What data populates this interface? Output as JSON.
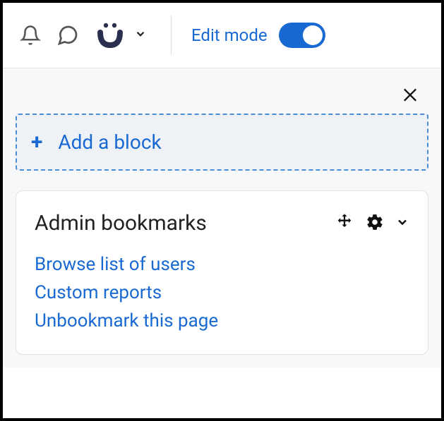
{
  "topbar": {
    "edit_mode_label": "Edit mode",
    "edit_mode_on": true
  },
  "drawer": {
    "add_block_label": "Add a block"
  },
  "block": {
    "title": "Admin bookmarks",
    "links": [
      "Browse list of users",
      "Custom reports",
      "Unbookmark this page"
    ]
  }
}
